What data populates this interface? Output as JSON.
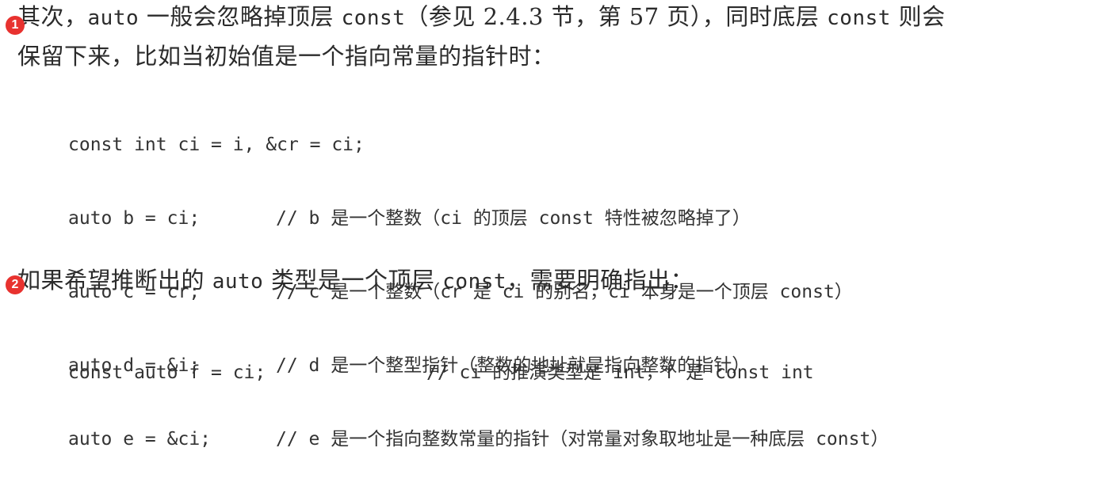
{
  "paragraph1": {
    "seg1": "其次，",
    "seg2": "auto",
    "seg3": " 一般会忽略掉顶层 ",
    "seg4": "const",
    "seg5": "（参见 2.4.3 节，第 57 页），同时底层 ",
    "seg6": "const",
    "seg7": " 则会",
    "line2": "保留下来，比如当初始值是一个指向常量的指针时："
  },
  "code1": [
    {
      "stmt": "const int ci = i, &cr = ci;",
      "comment": ""
    },
    {
      "stmt": "auto b = ci;",
      "comment": "// b 是一个整数（ci 的顶层 const 特性被忽略掉了）"
    },
    {
      "stmt": "auto c = cr;",
      "comment": "// c 是一个整数（cr 是 ci 的别名，ci 本身是一个顶层 const）"
    },
    {
      "stmt": "auto d = &i;",
      "comment": "// d 是一个整型指针（整数的地址就是指向整数的指针）"
    },
    {
      "stmt": "auto e = &ci;",
      "comment": "// e 是一个指向整数常量的指针（对常量对象取地址是一种底层 const）"
    }
  ],
  "paragraph2": {
    "seg1": "如果希望推断出的 ",
    "seg2": "auto",
    "seg3": " 类型是一个顶层 ",
    "seg4": "const",
    "seg5": "，需要明确指出："
  },
  "code2": [
    {
      "stmt": "const auto f = ci;",
      "comment": "// ci 的推演类型是 int，f 是 const int"
    }
  ],
  "badges": {
    "first": "1",
    "second": "2",
    "color": "#e8322f"
  }
}
